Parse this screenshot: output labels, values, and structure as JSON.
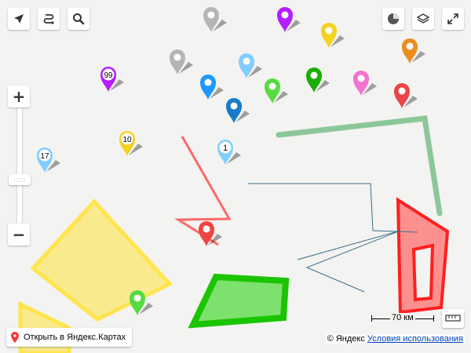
{
  "map": {
    "placemarks": [
      {
        "color": "#b5b5b5",
        "label": ""
      },
      {
        "color": "#b51eff",
        "label": ""
      },
      {
        "color": "#f5d21e",
        "label": ""
      },
      {
        "color": "#ed8c1e",
        "label": ""
      },
      {
        "color": "#b5b5b5",
        "label": ""
      },
      {
        "color": "#82cdff",
        "label": ""
      },
      {
        "color": "#1e98ff",
        "label": ""
      },
      {
        "color": "#1bad03",
        "label": ""
      },
      {
        "color": "#f371d1",
        "label": ""
      },
      {
        "color": "#ed4543",
        "label": ""
      },
      {
        "color": "#56db40",
        "label": ""
      },
      {
        "color": "#177bc9",
        "label": ""
      },
      {
        "color": "#b51eff",
        "label": "99"
      },
      {
        "color": "#f5d21e",
        "label": "10"
      },
      {
        "color": "#82cdff",
        "label": "1"
      },
      {
        "color": "#82cdff",
        "label": "17"
      },
      {
        "color": "#ed4543",
        "label": ""
      },
      {
        "color": "#56db40",
        "label": ""
      }
    ],
    "shapes": {
      "yellow_polygon_color": "#ffe44d",
      "green_polygon_color": "#1bc400",
      "red_polygon_color": "#ff1f1f",
      "red_line_color": "#ff5050",
      "green_line_color": "#8cc79a",
      "blue_line_color": "#3a6f8a"
    }
  },
  "controls": {
    "geolocation": "geolocation-icon",
    "routes": "route-icon",
    "search": "search-icon",
    "traffic": "traffic-icon",
    "layers": "layers-icon",
    "fullscreen": "fullscreen-icon",
    "zoom_in": "+",
    "zoom_out": "−",
    "zoom_handle": ":::::",
    "ruler": "ruler-icon"
  },
  "footer": {
    "open_link": "Открыть в Яндекс.Картах",
    "copyright": "© Яндекс",
    "terms_link": "Условия использования",
    "scale_label": "70 км"
  }
}
